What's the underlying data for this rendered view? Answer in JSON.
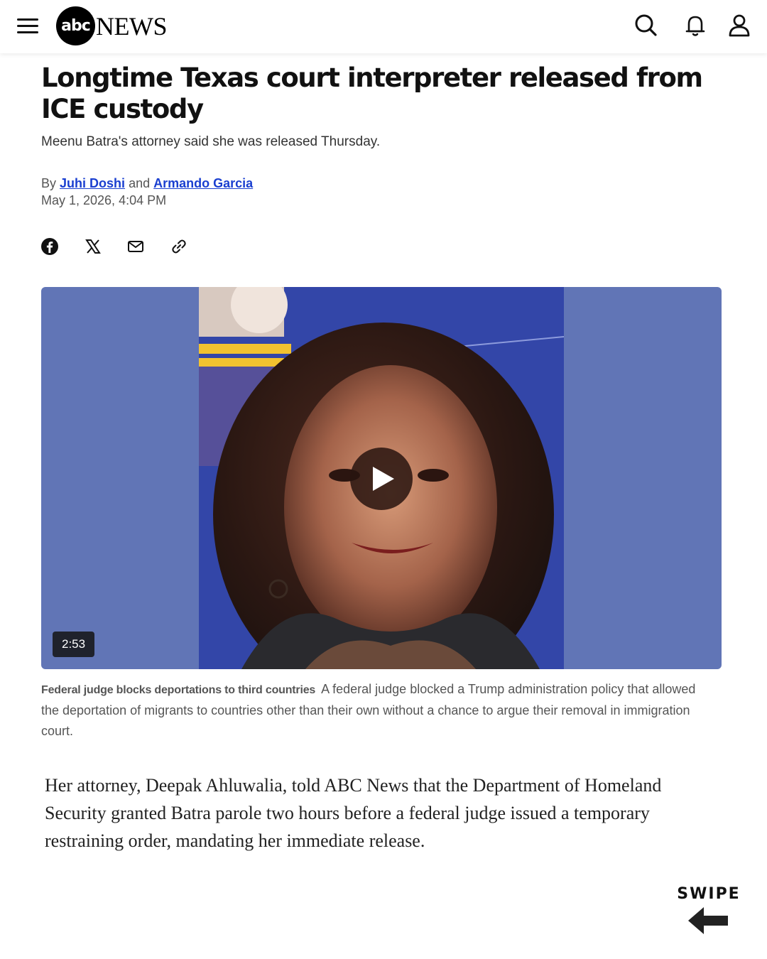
{
  "header": {
    "logo_mark": "abc",
    "logo_word": "NEWS",
    "icons": [
      "menu-icon",
      "search-icon",
      "bell-icon",
      "user-icon"
    ]
  },
  "article": {
    "headline": "Longtime Texas court interpreter released from ICE custody",
    "subhead": "Meenu Batra's attorney said she was released Thursday.",
    "byline": {
      "by": "By",
      "author1": "Juhi Doshi",
      "and": "and",
      "author2": "Armando Garcia"
    },
    "date": "May 1, 2026, 4:04 PM",
    "share_icons": [
      "facebook-icon",
      "x-icon",
      "email-icon",
      "link-icon"
    ]
  },
  "video": {
    "duration": "2:53",
    "caption_title": "Federal judge blocks deportations to third countries",
    "caption_text": "A federal judge blocked a Trump administration policy that allowed the deportation of migrants to countries other than their own without a chance to argue their removal in immigration court.",
    "bg_color": "#6175b6"
  },
  "body": {
    "paragraph": "Her attorney, Deepak Ahluwalia, told ABC News that the Department of Homeland Security granted Batra parole two hours before a federal judge issued a temporary restraining order, mandating her immediate release."
  },
  "swipe": {
    "label": "SWIPE",
    "icon": "arrow-left-icon"
  },
  "colors": {
    "link": "#1a3fd0",
    "text": "#111111",
    "muted": "#555555"
  }
}
